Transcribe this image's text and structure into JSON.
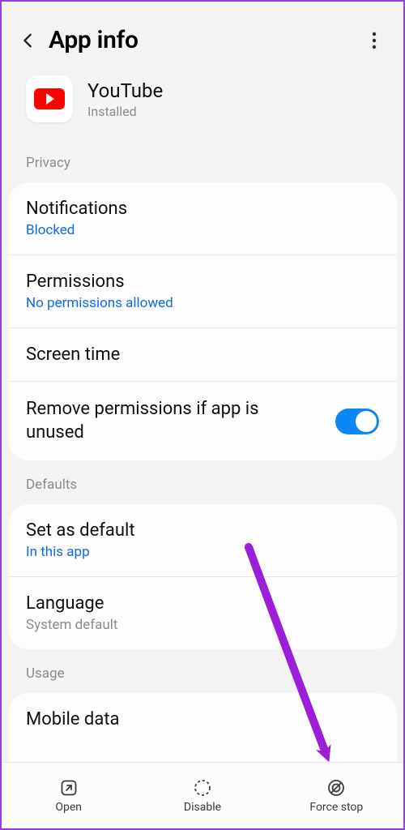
{
  "header": {
    "title": "App info"
  },
  "app": {
    "name": "YouTube",
    "status": "Installed"
  },
  "sections": {
    "privacy_label": "Privacy",
    "notifications": {
      "title": "Notifications",
      "sub": "Blocked"
    },
    "permissions": {
      "title": "Permissions",
      "sub": "No permissions allowed"
    },
    "screen_time": {
      "title": "Screen time"
    },
    "remove_perms": {
      "title": "Remove permissions if app is unused"
    },
    "defaults_label": "Defaults",
    "set_default": {
      "title": "Set as default",
      "sub": "In this app"
    },
    "language": {
      "title": "Language",
      "sub": "System default"
    },
    "usage_label": "Usage",
    "mobile_data": {
      "title": "Mobile data"
    }
  },
  "bottom": {
    "open": "Open",
    "disable": "Disable",
    "force_stop": "Force stop"
  },
  "colors": {
    "accent": "#0d6be8",
    "toggle": "#0d87f5",
    "annotation": "#9a1fd6"
  }
}
